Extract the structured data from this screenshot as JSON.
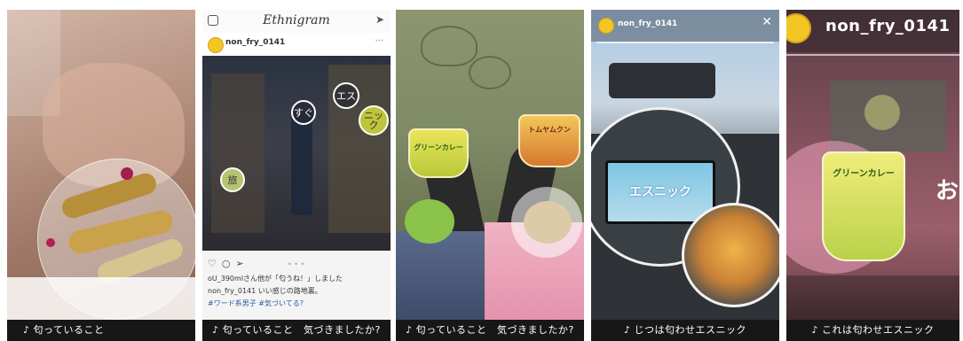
{
  "panels": [
    {
      "caption": "♪ 匂っていること"
    },
    {
      "app_title": "Ethnigram",
      "username": "non_fry_0141",
      "stickers": [
        "すぐ",
        "エス",
        "ニック",
        "旅"
      ],
      "likes_text": "oU_390mlさん他が「匂うね！」しました",
      "post_caption": "non_fry_0141 いい感じの路地裏。",
      "hashtags": "#ワード系男子 #気づいてる?",
      "caption": "♪ 匂っていること　気づきましたか?"
    },
    {
      "cup_label_left": "グリーンカレー",
      "cup_label_right": "トムヤムクン",
      "caption": "♪ 匂っていること　気づきましたか?"
    },
    {
      "username": "non_fry_0141",
      "screen_text": "エスニック",
      "caption": "♪ じつは匂わせエスニック"
    },
    {
      "username": "non_fry_0141",
      "cup_label": "グリーンカレー",
      "bg_char": "お",
      "caption": "♪ これは匂わせエスニック"
    }
  ],
  "colors": {
    "caption_bar": "#171717",
    "circle_highlight": "#ffffff"
  }
}
